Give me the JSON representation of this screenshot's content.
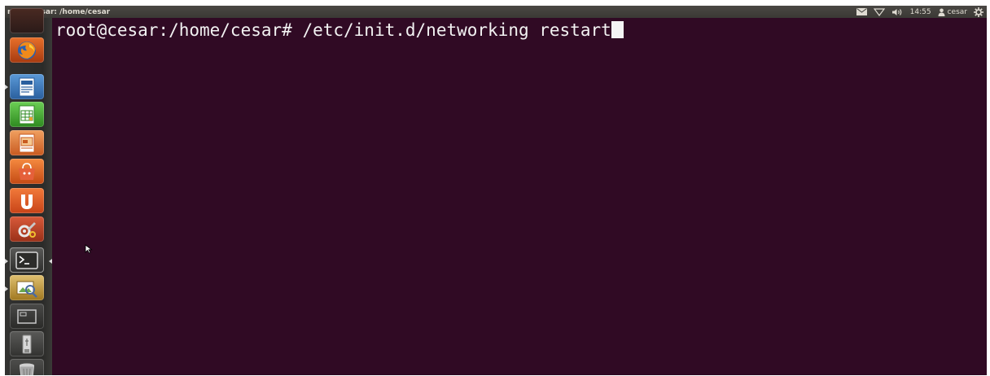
{
  "window": {
    "title": "root@cesar: /home/cesar"
  },
  "indicators": {
    "mail_icon": "mail-icon",
    "network_icon": "network-icon",
    "volume_icon": "volume-icon",
    "clock": "14:55",
    "user": "cesar",
    "session_icon": "gear-icon"
  },
  "launcher": {
    "items": [
      {
        "name": "dash-home",
        "icon": "dash-icon"
      },
      {
        "name": "firefox",
        "icon": "firefox-icon"
      },
      {
        "name": "libreoffice-writer",
        "icon": "writer-icon"
      },
      {
        "name": "libreoffice-calc",
        "icon": "calc-icon"
      },
      {
        "name": "libreoffice-impress",
        "icon": "impress-icon"
      },
      {
        "name": "software-center",
        "icon": "software-center-icon"
      },
      {
        "name": "ubuntu-one",
        "icon": "ubuntu-one-icon"
      },
      {
        "name": "system-settings",
        "icon": "settings-icon"
      },
      {
        "name": "terminal",
        "icon": "terminal-icon"
      },
      {
        "name": "image-viewer",
        "icon": "image-viewer-icon"
      },
      {
        "name": "workspace-switcher",
        "icon": "workspace-icon"
      },
      {
        "name": "usb-drive",
        "icon": "usb-icon"
      },
      {
        "name": "trash",
        "icon": "trash-icon"
      }
    ]
  },
  "terminal": {
    "prompt": "root@cesar:/home/cesar#",
    "command": "/etc/init.d/networking restart"
  },
  "colors": {
    "terminal_bg": "#300a24",
    "panel_bg": "#3c3b37",
    "launcher_bg": "#2b2b29",
    "text": "#f2f2f2"
  }
}
